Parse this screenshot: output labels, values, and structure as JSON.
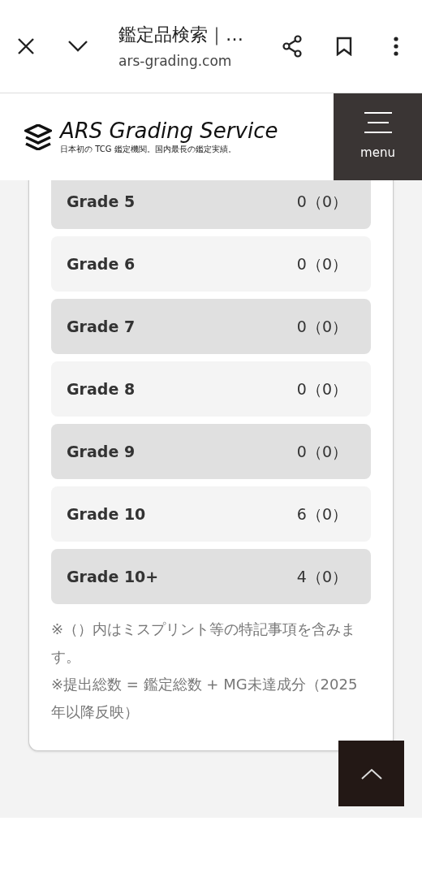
{
  "browser_bar": {
    "title": "鑑定品検索｜…",
    "url": "ars-grading.com"
  },
  "header": {
    "logo_text": "ARS Grading Service",
    "tagline": "日本初の TCG 鑑定機関。国内最長の鑑定実績。",
    "menu_label": "menu"
  },
  "grades": [
    {
      "label": "Grade 5",
      "count": "0（0）"
    },
    {
      "label": "Grade 6",
      "count": "0（0）"
    },
    {
      "label": "Grade 7",
      "count": "0（0）"
    },
    {
      "label": "Grade 8",
      "count": "0（0）"
    },
    {
      "label": "Grade 9",
      "count": "0（0）"
    },
    {
      "label": "Grade 10",
      "count": "6（0）"
    },
    {
      "label": "Grade 10+",
      "count": "4（0）"
    }
  ],
  "notes": [
    "※（）内はミスプリント等の特記事項を含みます。",
    "※提出総数 = 鑑定総数 + MG未達成分（2025年以降反映）"
  ]
}
